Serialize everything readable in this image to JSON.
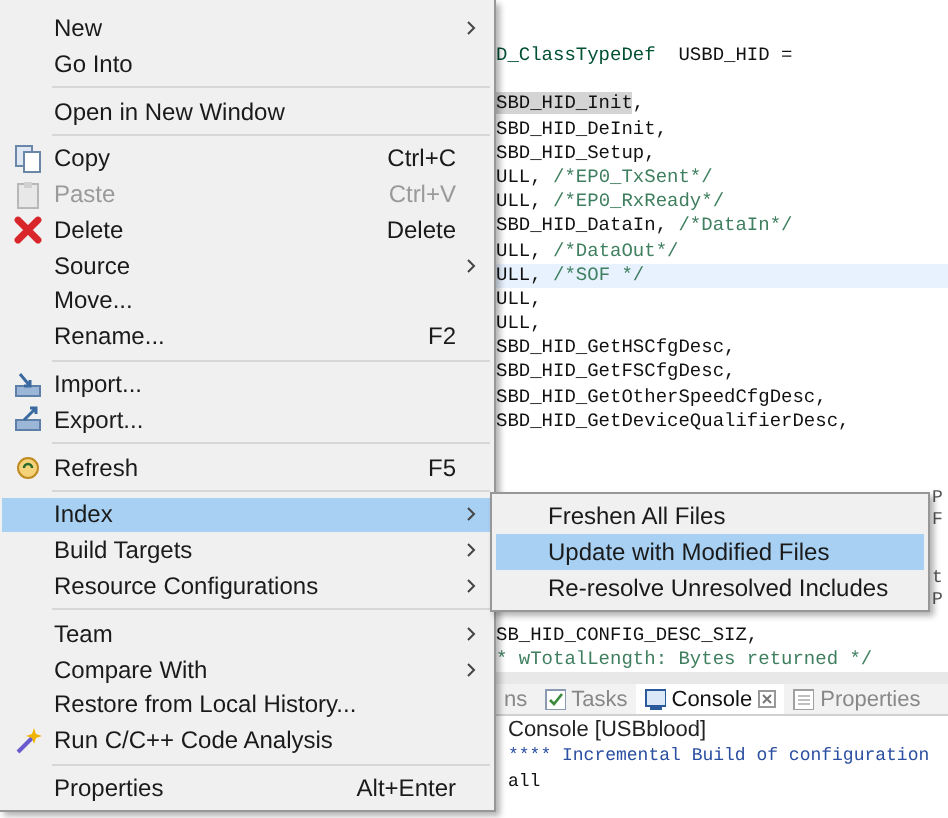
{
  "context_menu": {
    "items": [
      {
        "label": "New",
        "submenu": true,
        "selected": false
      },
      {
        "label": "Go Into",
        "selected": false
      },
      {
        "label": "Open in New Window",
        "separator_before": true,
        "selected": false
      },
      {
        "label": "Copy",
        "shortcut": "Ctrl+C",
        "separator_before": true,
        "selected": false
      },
      {
        "label": "Paste",
        "shortcut": "Ctrl+V",
        "disabled": true,
        "selected": false
      },
      {
        "label": "Delete",
        "shortcut": "Delete",
        "selected": false
      },
      {
        "label": "Source",
        "submenu": true,
        "selected": false
      },
      {
        "label": "Move...",
        "selected": false
      },
      {
        "label": "Rename...",
        "shortcut": "F2",
        "selected": false
      },
      {
        "label": "Import...",
        "separator_before": true,
        "selected": false
      },
      {
        "label": "Export...",
        "selected": false
      },
      {
        "label": "Refresh",
        "shortcut": "F5",
        "separator_before": true,
        "selected": false
      },
      {
        "label": "Index",
        "submenu": true,
        "separator_before": true,
        "selected": true
      },
      {
        "label": "Build Targets",
        "submenu": true,
        "selected": false
      },
      {
        "label": "Resource Configurations",
        "submenu": true,
        "selected": false
      },
      {
        "label": "Team",
        "submenu": true,
        "separator_before": true,
        "selected": false
      },
      {
        "label": "Compare With",
        "submenu": true,
        "selected": false
      },
      {
        "label": "Restore from Local History...",
        "selected": false
      },
      {
        "label": "Run C/C++ Code Analysis",
        "selected": false
      },
      {
        "label": "Properties",
        "shortcut": "Alt+Enter",
        "separator_before": true,
        "selected": false
      }
    ]
  },
  "submenu": {
    "items": [
      {
        "label": "Freshen All Files",
        "selected": false
      },
      {
        "label": "Update with Modified Files",
        "selected": true
      },
      {
        "label": "Re-resolve Unresolved Includes",
        "selected": false
      }
    ]
  },
  "editor": {
    "declaration": {
      "segments": [
        {
          "kind": "type",
          "text": "D_ClassTypeDef"
        },
        {
          "kind": "code",
          "text": "  USBD_HID ="
        }
      ]
    },
    "lines_top": [
      {
        "segments": [
          {
            "kind": "mark",
            "text": "SBD_HID_Init"
          },
          {
            "kind": "code",
            "text": ","
          }
        ]
      },
      {
        "segments": [
          {
            "kind": "code",
            "text": "SBD_HID_DeInit,"
          }
        ]
      },
      {
        "segments": [
          {
            "kind": "code",
            "text": "SBD_HID_Setup,"
          }
        ]
      },
      {
        "segments": [
          {
            "kind": "code",
            "text": "ULL, "
          },
          {
            "kind": "comment",
            "text": "/*EP0_TxSent*/"
          }
        ]
      },
      {
        "segments": [
          {
            "kind": "code",
            "text": "ULL, "
          },
          {
            "kind": "comment",
            "text": "/*EP0_RxReady*/"
          }
        ]
      },
      {
        "segments": [
          {
            "kind": "code",
            "text": "SBD_HID_DataIn, "
          },
          {
            "kind": "comment",
            "text": "/*DataIn*/"
          }
        ]
      },
      {
        "segments": [
          {
            "kind": "code",
            "text": "ULL, "
          },
          {
            "kind": "comment",
            "text": "/*DataOut*/"
          }
        ]
      },
      {
        "current": true,
        "segments": [
          {
            "kind": "code",
            "text": "ULL, "
          },
          {
            "kind": "comment",
            "text": "/*SOF */"
          }
        ]
      },
      {
        "segments": [
          {
            "kind": "code",
            "text": "ULL,"
          }
        ]
      },
      {
        "segments": [
          {
            "kind": "code",
            "text": "ULL,"
          }
        ]
      },
      {
        "segments": [
          {
            "kind": "code",
            "text": "SBD_HID_GetHSCfgDesc,"
          }
        ]
      },
      {
        "segments": [
          {
            "kind": "code",
            "text": "SBD_HID_GetFSCfgDesc,"
          }
        ]
      },
      {
        "segments": [
          {
            "kind": "code",
            "text": "SBD_HID_GetOtherSpeedCfgDesc,"
          }
        ]
      },
      {
        "segments": [
          {
            "kind": "code",
            "text": "SBD_HID_GetDeviceQualifierDesc,"
          }
        ]
      }
    ],
    "edge_fragments": [
      "P",
      "F",
      "t",
      "P"
    ],
    "lines_bottom": [
      {
        "segments": [
          {
            "kind": "code",
            "text": "SB_HID_CONFIG_DESC_SIZ,"
          }
        ]
      },
      {
        "segments": [
          {
            "kind": "comment",
            "text": "* wTotalLength: Bytes returned */"
          }
        ]
      }
    ]
  },
  "bottom_panel": {
    "tabs": [
      {
        "label": "ns",
        "selected": false
      },
      {
        "label": "Tasks",
        "selected": false
      },
      {
        "label": "Console",
        "closable": true,
        "selected": true
      },
      {
        "label": "Properties",
        "selected": false
      }
    ],
    "console_title": "Console [USBblood]",
    "console_lines": [
      "**** Incremental Build of configuration",
      "all"
    ]
  }
}
